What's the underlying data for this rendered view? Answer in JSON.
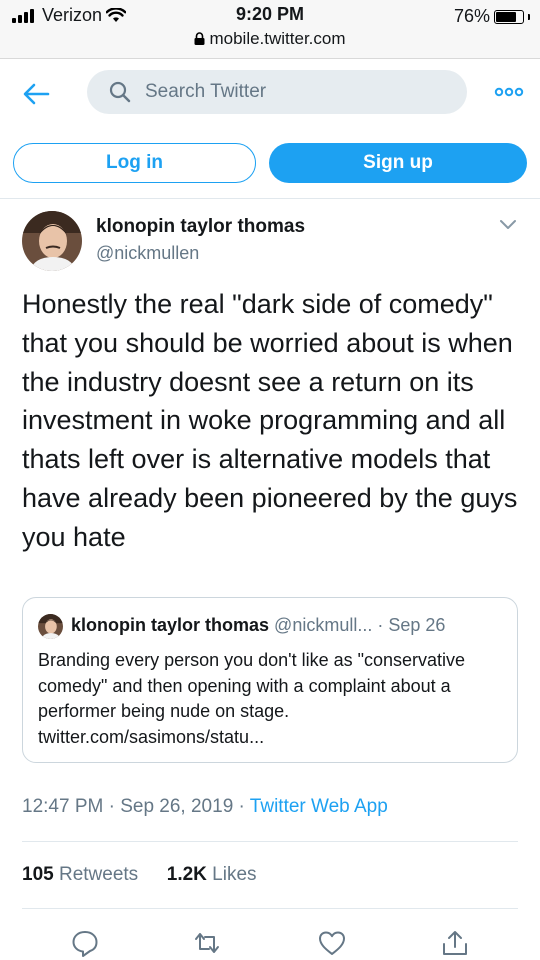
{
  "status_bar": {
    "carrier": "Verizon",
    "time": "9:20 PM",
    "url": "mobile.twitter.com",
    "battery": "76%",
    "battery_level": 0.76
  },
  "header": {
    "search_placeholder": "Search Twitter"
  },
  "auth": {
    "login": "Log in",
    "signup": "Sign up"
  },
  "tweet": {
    "name": "klonopin taylor thomas",
    "handle": "@nickmullen",
    "text": "Honestly the real \"dark side of comedy\" that you should be worried about is when the industry doesnt see a return on its investment in woke programming and all thats left over is alternative models that have already been pioneered by the guys you hate",
    "quote": {
      "name": "klonopin taylor thomas",
      "handle": "@nickmull...",
      "sep": "·",
      "date": "Sep 26",
      "text": "Branding every person you don't like as \"conservative comedy\" and then opening with a complaint about a performer being nude on stage. twitter.com/sasimons/statu..."
    },
    "timestamp": "12:47 PM · Sep 26, 2019 · ",
    "source": "Twitter Web App",
    "retweets_count": "105",
    "retweets_label": "Retweets",
    "likes_count": "1.2K",
    "likes_label": "Likes"
  },
  "icons": {
    "back": "back-arrow-icon",
    "search": "search-icon",
    "more": "more-icon",
    "reply": "reply-icon",
    "retweet": "retweet-icon",
    "like": "heart-icon",
    "share": "share-icon"
  },
  "colors": {
    "accent": "#1da1f2",
    "secondary_text": "#657786",
    "search_bg": "#e6ecf0"
  }
}
